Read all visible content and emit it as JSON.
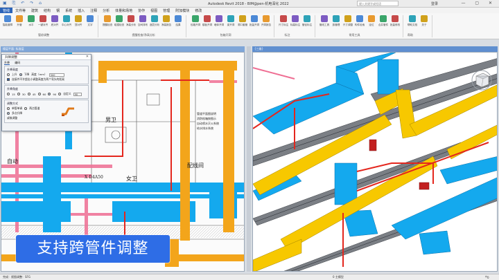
{
  "app": {
    "title": "Autodesk Revit 2018 -",
    "file": "BIM@pen-机电深化 2022",
    "search_placeholder": "键入关键字或短语",
    "login": "登录"
  },
  "menu": {
    "items": [
      "管线",
      "文件等",
      "建筑",
      "结构",
      "钢",
      "系统",
      "插入",
      "注释",
      "分析",
      "体量和场地",
      "协作",
      "视图",
      "管理",
      "附加模块",
      "修改"
    ],
    "active_index": 0
  },
  "ribbon": {
    "groups": [
      {
        "label": "管综调整",
        "buttons": [
          "智能避障",
          "升管",
          "水平",
          "一键对齐",
          "底对齐",
          "中心对齐",
          "顶对齐",
          "文字"
        ]
      },
      {
        "label": "提醒检查/净高分析",
        "buttons": [
          "提醒检查",
          "碰撞检查",
          "净高分析",
          "空间排布",
          "逐层分析",
          "净高报告",
          "结果"
        ]
      },
      {
        "label": "包箱开洞",
        "buttons": [
          "包箱开洞",
          "楼板开洞",
          "墙体开洞",
          "梁开洞",
          "洞口套管",
          "批量开洞",
          "开洞报告"
        ]
      },
      {
        "label": "标注",
        "buttons": [
          "尺寸标注",
          "标高标注",
          "管径标注"
        ]
      },
      {
        "label": "常用工具",
        "buttons": [
          "管线工具",
          "族管理",
          "尺寸调整",
          "构件检索",
          "定位",
          "合并管件",
          "批量修改"
        ]
      },
      {
        "label": "帮助",
        "buttons": [
          "帮助文档",
          "关于"
        ]
      }
    ]
  },
  "views": {
    "left_title": "楼层平面: 标准层",
    "right_title": "{三维}"
  },
  "dialog": {
    "title": "升降调整",
    "tabs": [
      "升降",
      "编码"
    ],
    "g1": {
      "legend": "升降高度",
      "up": "上升",
      "down": "下降",
      "height_label": "高度（mm）",
      "height_value": "500",
      "note": "连接件不许超出小调整高度为两个弯头的距离"
    },
    "g2": {
      "legend": "升降角度",
      "angles": [
        "15",
        "30",
        "45",
        "60",
        "90",
        "自定义"
      ],
      "custom_value": "90"
    },
    "g3": {
      "legend": "调整方式",
      "opt1": "单管单调",
      "opt2": "两点管道",
      "opt3": "多点升降",
      "last": "或故调整"
    }
  },
  "caption": "支持跨管件调整",
  "status": {
    "left": "完成：视图调整：SFG",
    "mid": "0 主模型",
    "filter": "0"
  },
  "colors": {
    "duct_blue": "#14a9ee",
    "duct_orange": "#f3a51b",
    "duct_yellow": "#f7c800",
    "pipe_red": "#e4261d",
    "pipe_pink": "#ef6e93",
    "accent": "#2e6de6"
  },
  "floorplan_labels": {
    "room1": "配线间",
    "room2": "女卫",
    "room3": "自动",
    "room4": "男卫",
    "axis": "X D4A50",
    "notes": [
      "管道平面图说明",
      "消防栓箱按图示",
      "自动喷水灭火系统",
      "给水排水系统"
    ]
  }
}
